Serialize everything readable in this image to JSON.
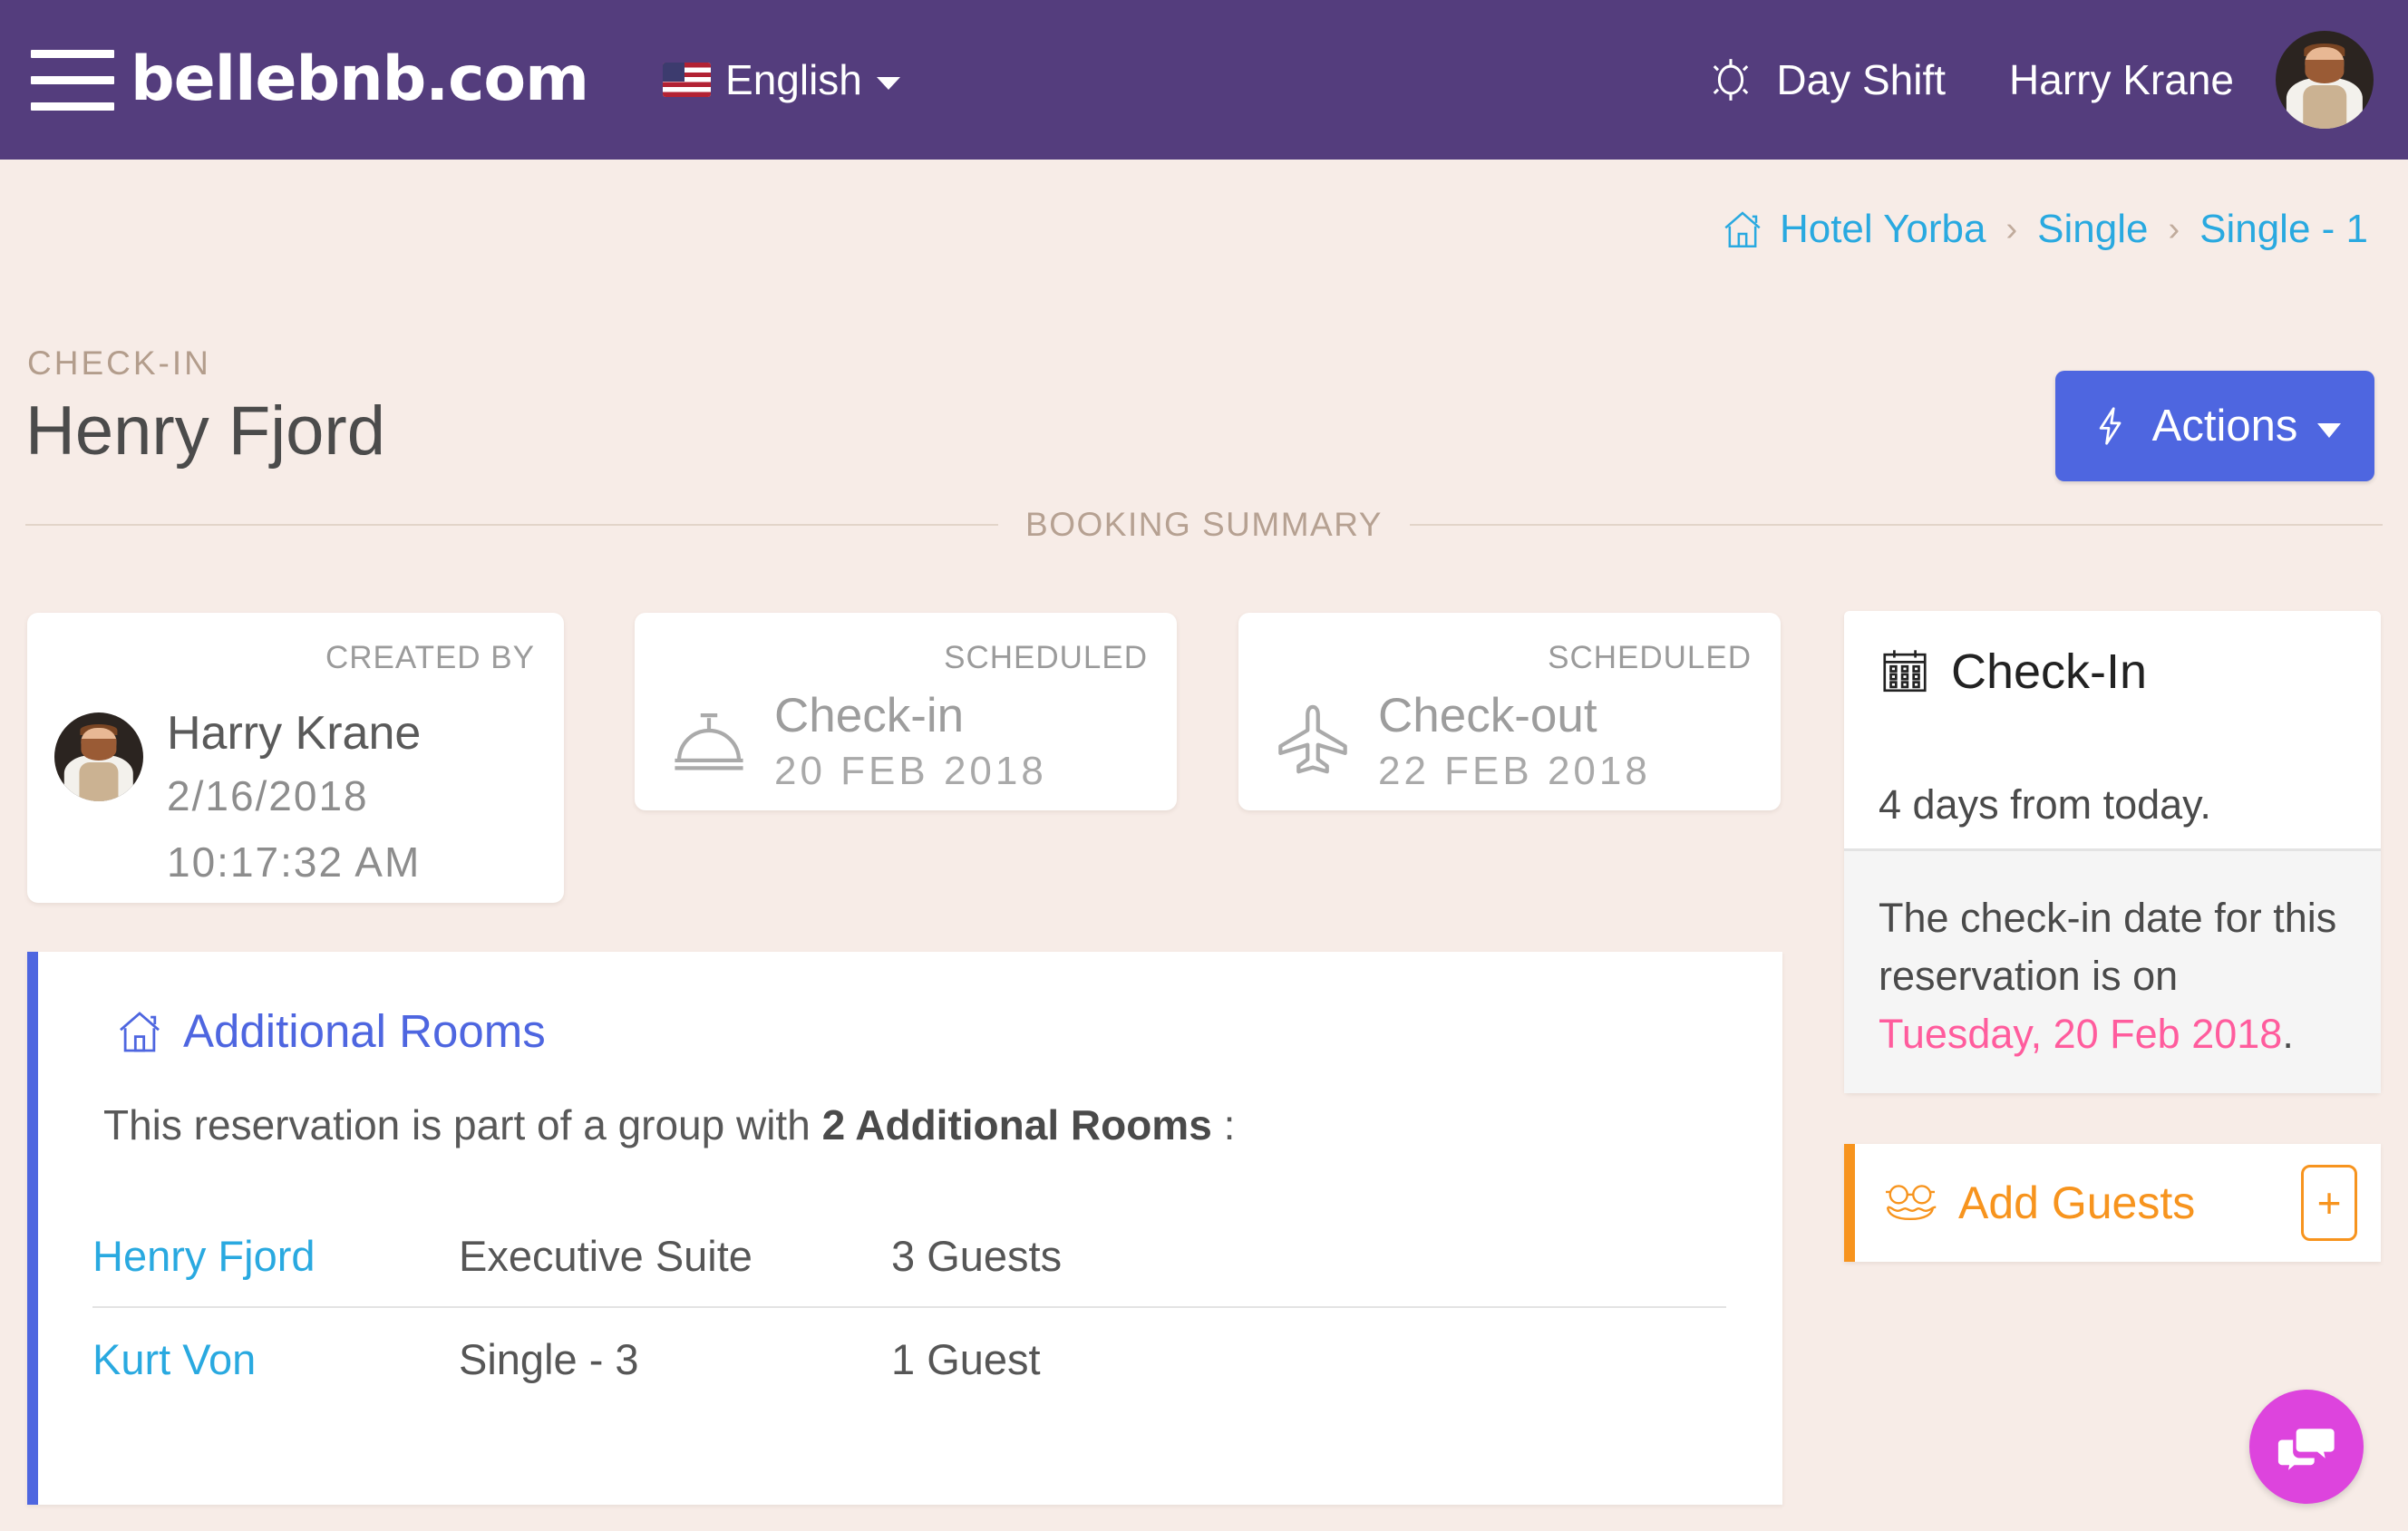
{
  "navbar": {
    "menu_icon": "hamburger-menu-icon",
    "brand": "bellebnb.com",
    "language": {
      "label": "English",
      "flag": "us-flag-icon"
    },
    "shift": {
      "label": "Day Shift",
      "icon": "sun-icon"
    },
    "user": {
      "name": "Harry Krane",
      "avatar": "user-avatar"
    }
  },
  "breadcrumb": {
    "home_icon": "house-icon",
    "items": [
      {
        "label": "Hotel Yorba"
      },
      {
        "label": "Single"
      },
      {
        "label": "Single - 1"
      }
    ],
    "separator": "›"
  },
  "page": {
    "kicker": "CHECK-IN",
    "title": "Henry Fjord",
    "actions_button": {
      "label": "Actions",
      "icon": "lightning-bolt-icon"
    },
    "section_divider_label": "BOOKING SUMMARY"
  },
  "summary": {
    "created": {
      "tag": "CREATED BY",
      "name": "Harry Krane",
      "date": "2/16/2018",
      "time": "10:17:32 AM",
      "avatar": "user-avatar"
    },
    "checkin": {
      "tag": "SCHEDULED",
      "title": "Check-in",
      "date": "20 FEB 2018",
      "icon": "service-bell-icon"
    },
    "checkout": {
      "tag": "SCHEDULED",
      "title": "Check-out",
      "date": "22 FEB 2018",
      "icon": "airplane-icon"
    }
  },
  "additional_rooms": {
    "icon": "house-icon",
    "heading": "Additional Rooms",
    "subtitle_prefix": "This reservation is part of a group with ",
    "subtitle_count": "2 Additional Rooms",
    "subtitle_suffix": " :",
    "rows": [
      {
        "guest": "Henry Fjord",
        "room": "Executive Suite",
        "guests": "3 Guests"
      },
      {
        "guest": "Kurt Von",
        "room": "Single - 3",
        "guests": "1 Guest"
      }
    ]
  },
  "sidebar": {
    "checkin_card": {
      "icon": "calendar-icon",
      "title": "Check-In",
      "days_text": "4 days from today.",
      "note_prefix": "The check-in date for this reservation is on ",
      "note_date": "Tuesday, 20 Feb 2018",
      "note_suffix": "."
    },
    "add_guests": {
      "icon": "glasses-mustache-icon",
      "label": "Add Guests",
      "plus_label": "+"
    }
  },
  "chat": {
    "icon": "chat-bubbles-icon"
  },
  "colors": {
    "header_purple": "#543d7d",
    "page_bg": "#f7ece7",
    "accent_blue": "#4e66e0",
    "link_blue": "#29a9e0",
    "orange": "#f7941e",
    "pink": "#ff5c9d",
    "magenta": "#dd44dd",
    "muted_tan": "#b6a192"
  }
}
